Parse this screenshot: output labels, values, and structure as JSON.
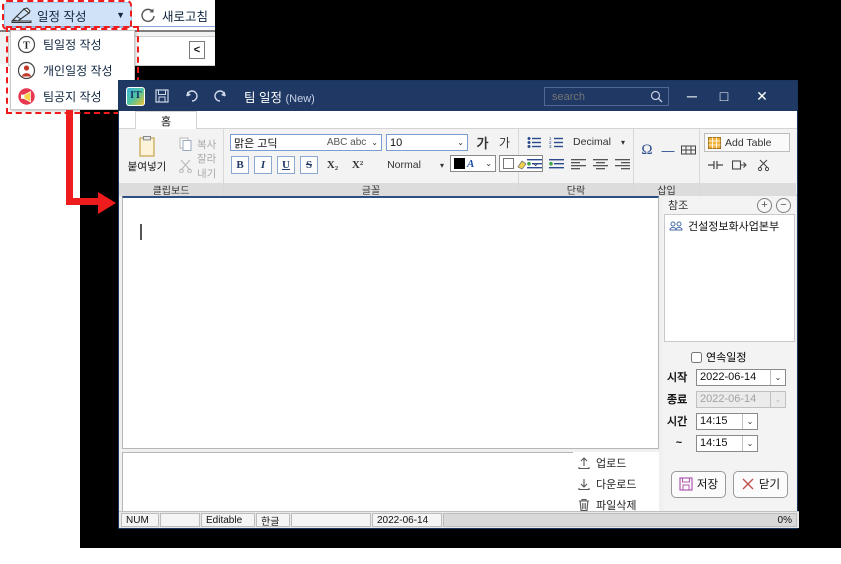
{
  "host": {
    "compose_button": "일정 작성",
    "refresh_button": "새로고침",
    "collapse_button": "<",
    "menu": [
      {
        "label": "팀일정 작성",
        "icon": "team-circle-icon"
      },
      {
        "label": "개인일정 작성",
        "icon": "person-circle-icon"
      },
      {
        "label": "팀공지 작성",
        "icon": "megaphone-circle-icon"
      }
    ]
  },
  "window": {
    "title": "팀 일정",
    "title_suffix": "(New)",
    "quick_access": [
      "save-icon",
      "undo-icon",
      "redo-icon"
    ],
    "search": {
      "placeholder": "search",
      "value": ""
    },
    "controls": {
      "minimize": "─",
      "maximize": "□",
      "close": "✕"
    }
  },
  "ribbon": {
    "tabs": [
      {
        "label": "홈"
      }
    ],
    "groups": {
      "clipboard": {
        "label": "클립보드",
        "paste": "붙여넣기",
        "copy": "복사",
        "cut": "잘라내기"
      },
      "font": {
        "label": "글꼴",
        "font_name": "맑은 고딕",
        "font_case": "ABC abc",
        "font_size": "10",
        "bold": "B",
        "italic": "I",
        "underline": "U",
        "strike": "S",
        "subscript": "X₂",
        "superscript": "X²",
        "style": "Normal",
        "grow": "가",
        "shrink": "가"
      },
      "paragraph": {
        "label": "단락",
        "numbering": "Decimal"
      },
      "insert": {
        "label": "삽입",
        "symbol": "Ω",
        "line": "—"
      },
      "table": {
        "add_table": "Add Table"
      }
    }
  },
  "document": {
    "content": ""
  },
  "side": {
    "reference": {
      "title": "참조",
      "add": "+",
      "remove": "−",
      "items": [
        {
          "label": "건설정보화사업본부",
          "icon": "group-icon"
        }
      ]
    },
    "schedule": {
      "recurring_label": "연속일정",
      "recurring_checked": false,
      "start_label": "시작",
      "start_value": "2022-06-14",
      "end_label": "종료",
      "end_value": "2022-06-14",
      "end_disabled": true,
      "time_label": "시간",
      "time_from": "14:15",
      "tilde_label": "~",
      "time_to": "14:15"
    }
  },
  "attachments": {
    "upload": "업로드",
    "download": "다운로드",
    "delete": "파일삭제"
  },
  "actions": {
    "save": "저장",
    "close": "닫기"
  },
  "statusbar": {
    "cells": [
      "NUM",
      "",
      "Editable",
      "한글",
      "",
      "2022-06-14"
    ],
    "progress": "0%"
  },
  "colors": {
    "titlebar": "#1f3864",
    "accent": "#ee1c1c",
    "ribbon_group_label": "#dcdcdc",
    "compose_button": "#cfe2f7"
  }
}
